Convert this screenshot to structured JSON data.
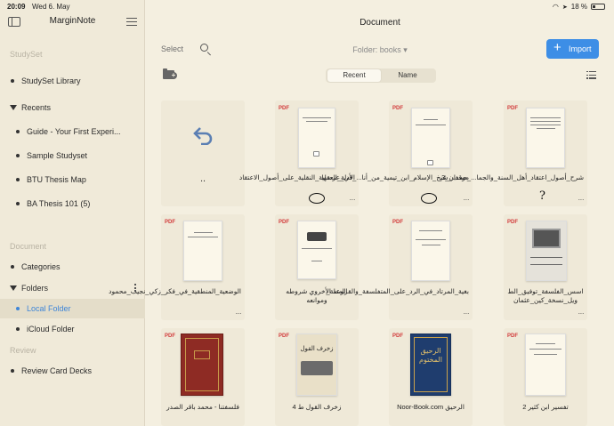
{
  "status": {
    "time": "20:09",
    "date": "Wed 6. May",
    "battery": "18 %"
  },
  "sidebar": {
    "title": "MarginNote",
    "studyset_section": "StudySet",
    "library_label": "StudySet Library",
    "recents_label": "Recents",
    "recents": [
      "Guide - Your First Experi...",
      "Sample Studyset",
      "BTU Thesis Map",
      "BA Thesis 101 (5)"
    ],
    "document_section": "Document",
    "categories_label": "Categories",
    "folders_label": "Folders",
    "local_folder": "Local Folder",
    "icloud_folder": "iCloud Folder",
    "review_section": "Review",
    "review_decks": "Review Card Decks"
  },
  "main": {
    "title": "Document",
    "select": "Select",
    "folder_selector": "Folder: books ▾",
    "import": "Import",
    "tabs": {
      "recent": "Recent",
      "name": "Name"
    },
    "parent_label": "..",
    "pdf_tag": "PDF",
    "more": "···",
    "cards": [
      {
        "name": "الأدلة_العقلية_النقلية_على_أصول_الاعتقاد"
      },
      {
        "name": "موقف_شيخ_الإسلام_ابن_تيمية_من_أنا..._في_عرضها"
      },
      {
        "name": "شرح_أصول_اعتقاد_أهل_السنة_والجما..._حمدان_3_"
      },
      {
        "name": "الوضعية_المنطقية_في_فكر_زكي_نجيب_محمود"
      },
      {
        "name": "الوعد الأخروي شروطه وموانعه"
      },
      {
        "name": "بغية_المرتاد_في_الرد_على_المتفلسفة_والقرامطة_"
      },
      {
        "name": "اسس_الفلسفة_توفيق_الط ويل_نسخة_كين_عثمان"
      },
      {
        "name": "فلسفتنا - محمد باقر الصدر"
      },
      {
        "name": "زخرف القول ط 4"
      },
      {
        "name": "Noor-Book.com الرحيق"
      },
      {
        "name": "تفسير ابن كثير 2"
      }
    ],
    "thumb_titles": {
      "b8": "زخرف القول",
      "b9": "الرحيق المختوم"
    }
  }
}
